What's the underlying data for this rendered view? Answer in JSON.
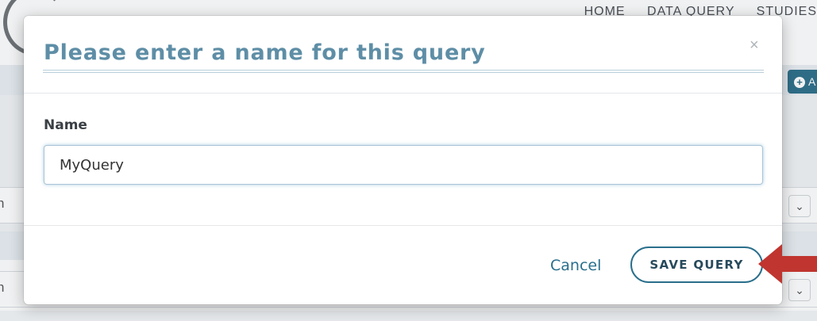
{
  "background": {
    "nav_items": [
      "HOME",
      "DATA QUERY",
      "STUDIES"
    ],
    "add_button_label": "A",
    "row_fragment": "n",
    "chevron_glyph": "⌄"
  },
  "dialog": {
    "title": "Please enter a name for this query",
    "close_glyph": "×",
    "name_label": "Name",
    "name_value": "MyQuery",
    "cancel_label": "Cancel",
    "save_label": "SAVE QUERY"
  },
  "colors": {
    "accent": "#2a6f8c",
    "title": "#5e8ea6",
    "annotation_arrow": "#c0352f"
  },
  "icons": {
    "close": "close-icon",
    "plus": "plus-circle-icon",
    "chevron": "chevron-down-icon",
    "annotation": "arrow-left-icon"
  }
}
